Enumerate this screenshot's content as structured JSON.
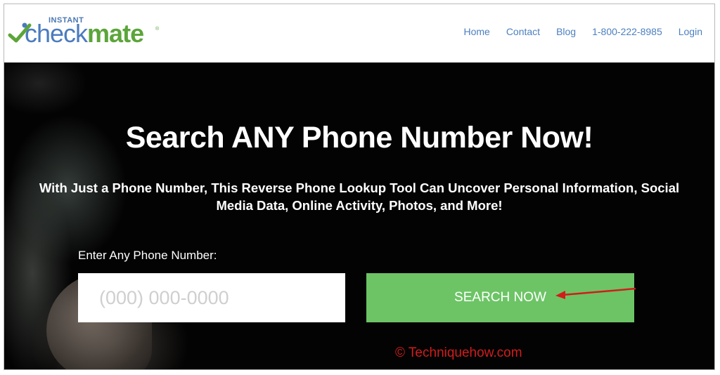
{
  "brand": {
    "top_text": "INSTANT",
    "word_part1": "check",
    "word_part2": "mate",
    "reg_mark": "®",
    "color_blue": "#4b7bbf",
    "color_green": "#5ca53a"
  },
  "nav": {
    "items": [
      {
        "label": "Home"
      },
      {
        "label": "Contact"
      },
      {
        "label": "Blog"
      },
      {
        "label": "1-800-222-8985"
      },
      {
        "label": "Login"
      }
    ],
    "link_color": "#4c7fbf"
  },
  "hero": {
    "title": "Search ANY Phone Number Now!",
    "subtitle_line1": "With Just a Phone Number, This Reverse Phone Lookup Tool Can Uncover Personal Information, Social",
    "subtitle_line2": "Media Data, Online Activity, Photos, and More!",
    "input_label": "Enter Any Phone Number:",
    "input_placeholder": "(000) 000-0000",
    "input_value": "",
    "button_label": "SEARCH NOW",
    "button_color": "#6cc465"
  },
  "annotation": {
    "arrow_color": "#d21c1c",
    "watermark": "© Techniquehow.com"
  }
}
